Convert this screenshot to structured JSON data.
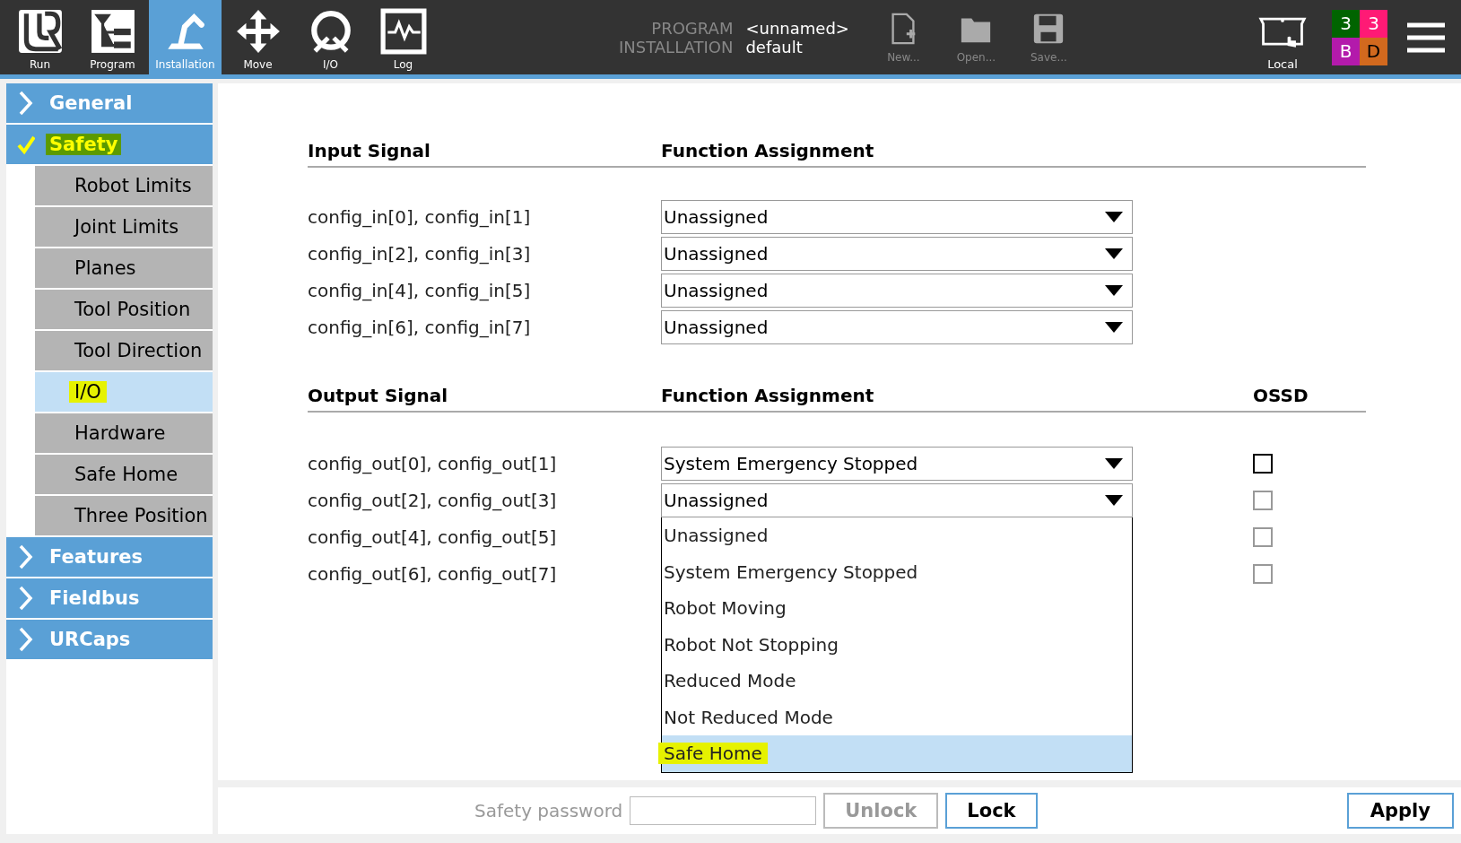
{
  "toolbar": {
    "nav": [
      {
        "label": "Run",
        "kind": "logo",
        "selected": false
      },
      {
        "label": "Program",
        "kind": "tree",
        "selected": false
      },
      {
        "label": "Installation",
        "kind": "arm",
        "selected": true
      },
      {
        "label": "Move",
        "kind": "move",
        "selected": false
      },
      {
        "label": "I/O",
        "kind": "io",
        "selected": false
      },
      {
        "label": "Log",
        "kind": "log",
        "selected": false
      }
    ],
    "info": [
      {
        "label": "PROGRAM",
        "value": "<unnamed>"
      },
      {
        "label": "INSTALLATION",
        "value": "default"
      }
    ],
    "file_actions": [
      {
        "label": "New...",
        "kind": "new"
      },
      {
        "label": "Open...",
        "kind": "open"
      },
      {
        "label": "Save...",
        "kind": "save"
      }
    ],
    "mode": {
      "label": "Local"
    },
    "badges": [
      {
        "text": "3",
        "color": "#006400"
      },
      {
        "text": "3",
        "color": "#ff1a75"
      },
      {
        "text": "B",
        "color": "#b31aab"
      },
      {
        "text": "D",
        "color": "#d2691e"
      }
    ]
  },
  "sidebar": {
    "items": [
      {
        "label": "General",
        "expanded": false,
        "highlighted": false
      },
      {
        "label": "Safety",
        "expanded": true,
        "highlighted": true,
        "children": [
          {
            "label": "Robot Limits",
            "selected": false,
            "highlighted": false
          },
          {
            "label": "Joint Limits",
            "selected": false,
            "highlighted": false
          },
          {
            "label": "Planes",
            "selected": false,
            "highlighted": false
          },
          {
            "label": "Tool Position",
            "selected": false,
            "highlighted": false
          },
          {
            "label": "Tool Direction",
            "selected": false,
            "highlighted": false
          },
          {
            "label": "I/O",
            "selected": true,
            "highlighted": true
          },
          {
            "label": "Hardware",
            "selected": false,
            "highlighted": false
          },
          {
            "label": "Safe Home",
            "selected": false,
            "highlighted": false
          },
          {
            "label": "Three Position",
            "selected": false,
            "highlighted": false
          }
        ]
      },
      {
        "label": "Features",
        "expanded": false,
        "highlighted": false
      },
      {
        "label": "Fieldbus",
        "expanded": false,
        "highlighted": false
      },
      {
        "label": "URCaps",
        "expanded": false,
        "highlighted": false
      }
    ]
  },
  "inputs": {
    "columns": [
      "Input Signal",
      "Function Assignment"
    ],
    "rows": [
      {
        "signal": "config_in[0], config_in[1]",
        "assignment": "Unassigned"
      },
      {
        "signal": "config_in[2], config_in[3]",
        "assignment": "Unassigned"
      },
      {
        "signal": "config_in[4], config_in[5]",
        "assignment": "Unassigned"
      },
      {
        "signal": "config_in[6], config_in[7]",
        "assignment": "Unassigned"
      }
    ]
  },
  "outputs": {
    "columns": [
      "Output Signal",
      "Function Assignment",
      "OSSD"
    ],
    "rows": [
      {
        "signal": "config_out[0], config_out[1]",
        "assignment": "System Emergency Stopped",
        "ossd": false,
        "disabled": false
      },
      {
        "signal": "config_out[2], config_out[3]",
        "assignment": "Unassigned",
        "ossd": false,
        "disabled": true,
        "expanded": true
      },
      {
        "signal": "config_out[4], config_out[5]",
        "ossd": false,
        "disabled": true
      },
      {
        "signal": "config_out[6], config_out[7]",
        "ossd": false,
        "disabled": true
      }
    ]
  },
  "dropdown_options": [
    {
      "label": "Unassigned",
      "selected": false,
      "highlighted": false
    },
    {
      "label": "System Emergency Stopped",
      "selected": false,
      "highlighted": false
    },
    {
      "label": "Robot Moving",
      "selected": false,
      "highlighted": false
    },
    {
      "label": "Robot Not Stopping",
      "selected": false,
      "highlighted": false
    },
    {
      "label": "Reduced Mode",
      "selected": false,
      "highlighted": false
    },
    {
      "label": "Not Reduced Mode",
      "selected": false,
      "highlighted": false
    },
    {
      "label": "Safe Home",
      "selected": true,
      "highlighted": true
    }
  ],
  "footer": {
    "password": {
      "label": "Safety password"
    },
    "buttons": [
      {
        "label": "Unlock",
        "disabled": true
      },
      {
        "label": "Lock",
        "disabled": false
      }
    ],
    "apply": "Apply"
  }
}
